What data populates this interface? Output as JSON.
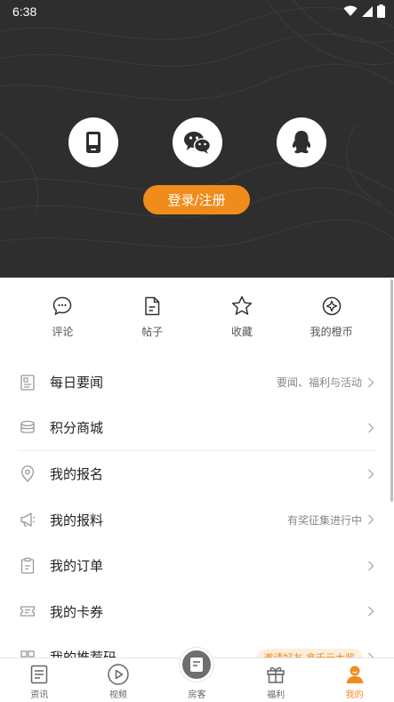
{
  "status_bar": {
    "time": "6:38"
  },
  "login": {
    "methods": [
      {
        "name": "phone-login",
        "icon": "phone-icon"
      },
      {
        "name": "wechat-login",
        "icon": "wechat-icon"
      },
      {
        "name": "qq-login",
        "icon": "qq-icon"
      }
    ],
    "button_label": "登录/注册"
  },
  "quick_actions": [
    {
      "label": "评论",
      "icon": "comment-icon"
    },
    {
      "label": "帖子",
      "icon": "post-icon"
    },
    {
      "label": "收藏",
      "icon": "star-icon"
    },
    {
      "label": "我的橙币",
      "icon": "coin-icon"
    }
  ],
  "menu": [
    {
      "label": "每日要闻",
      "hint": "要闻、福利与活动",
      "icon": "newspaper-icon"
    },
    {
      "label": "积分商城",
      "hint": "",
      "icon": "coins-stack-icon"
    },
    {
      "label": "我的报名",
      "hint": "",
      "icon": "location-pin-icon"
    },
    {
      "label": "我的报料",
      "hint": "有奖征集进行中",
      "icon": "megaphone-icon"
    },
    {
      "label": "我的订单",
      "hint": "",
      "icon": "clipboard-icon"
    },
    {
      "label": "我的卡券",
      "hint": "",
      "icon": "ticket-icon"
    },
    {
      "label": "我的推荐码",
      "hint": "邀请好友 拿千元大奖",
      "icon": "qr-icon"
    }
  ],
  "bottom_nav": [
    {
      "label": "资讯",
      "icon": "news-icon",
      "active": false
    },
    {
      "label": "视频",
      "icon": "play-icon",
      "active": false
    },
    {
      "label": "房客",
      "icon": "document-icon",
      "active": false
    },
    {
      "label": "福利",
      "icon": "gift-icon",
      "active": false
    },
    {
      "label": "我的",
      "icon": "user-icon",
      "active": true
    }
  ],
  "colors": {
    "accent": "#f08c1c",
    "header_bg": "#2e2e2e"
  }
}
